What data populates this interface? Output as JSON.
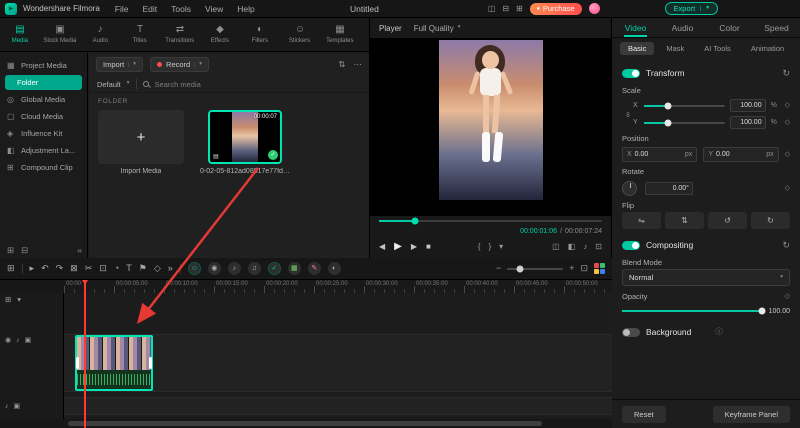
{
  "colors": {
    "accent": "#00c9a3",
    "selection": "#00e5b4",
    "purchase": "#ff5f3d",
    "record_dot": "#ff4d4f",
    "check_badge": "#2ecc71",
    "annotation_arrow": "#e53935",
    "playhead": "#ff3b30"
  },
  "icons": {
    "logo": "▶",
    "caret": "▾",
    "more": "⋯",
    "filter": "⇅",
    "plus": "+",
    "check": "✓",
    "reset": "↻",
    "keyframe": "◇",
    "info": "ⓘ",
    "link": "∞",
    "layout": "◫",
    "screen": "⊟",
    "mini": "⊞",
    "gem": "♦",
    "new_folder": "⊞",
    "del_folder": "⊟",
    "collapse": "«",
    "clip_type": "▤",
    "prev": "◀",
    "play": "▶",
    "next": "▶",
    "stop": "■",
    "brace_l": "{",
    "brace_r": "}",
    "mark_down": "▾",
    "display": "◫",
    "snapshot": "◧",
    "speaker": "♪",
    "fit": "⊡",
    "flip_h": "⇋",
    "flip_v": "⇅",
    "rot_ccw": "↺",
    "rot_cw": "↻",
    "tl_tracks": "⊞",
    "tl_pointer": "▸",
    "tl_undo": "↶",
    "tl_redo": "↷",
    "tl_delete": "⊠",
    "tl_split": "✂",
    "tl_crop": "⊡",
    "tl_speed": "◔",
    "tl_text": "T",
    "tl_marker": "⚑",
    "tl_keyframe": "◇",
    "tl_more": "»",
    "zoom_out": "−",
    "zoom_in": "+",
    "f1": "☺",
    "f2": "◉",
    "f3": "♪",
    "f4": "♫",
    "f5": "✓",
    "f6": "▦",
    "f7": "✎",
    "f8": "◐",
    "eye": "◉",
    "mute": "♪",
    "lock": "▣",
    "add_track": "⊞",
    "track_caret": "▾"
  },
  "menubar": {
    "app": "Wondershare Filmora",
    "menus": [
      "File",
      "Edit",
      "Tools",
      "View",
      "Help"
    ],
    "title": "Untitled",
    "purchase": "Purchase",
    "export": "Export"
  },
  "media_tabs": [
    {
      "label": "Media",
      "icon": "▤"
    },
    {
      "label": "Stock Media",
      "icon": "▣"
    },
    {
      "label": "Audio",
      "icon": "♪"
    },
    {
      "label": "Titles",
      "icon": "T"
    },
    {
      "label": "Transitions",
      "icon": "⇄"
    },
    {
      "label": "Effects",
      "icon": "◆"
    },
    {
      "label": "Filters",
      "icon": "◐"
    },
    {
      "label": "Stickers",
      "icon": "☺"
    },
    {
      "label": "Templates",
      "icon": "▦"
    }
  ],
  "sidebar": {
    "items": [
      {
        "label": "Project Media",
        "icon": "▦"
      },
      {
        "label": "Folder",
        "icon": ""
      },
      {
        "label": "Global Media",
        "icon": "◎"
      },
      {
        "label": "Cloud Media",
        "icon": "▢"
      },
      {
        "label": "Influence Kit",
        "icon": "◈"
      },
      {
        "label": "Adjustment La...",
        "icon": "◧"
      },
      {
        "label": "Compound Clip",
        "icon": "⊞"
      }
    ]
  },
  "media": {
    "import_btn": "Import",
    "record_btn": "Record",
    "default_dropdown": "Default",
    "search_placeholder": "Search media",
    "section_label": "FOLDER",
    "import_tile_label": "Import Media",
    "clip_name": "0-02-05-812ad08517e77fd6...",
    "clip_duration": "00:00:07"
  },
  "player": {
    "label": "Player",
    "quality": "Full Quality",
    "current_time": "00:00:01:06",
    "separator": "/",
    "total_time": "00:00:07:24"
  },
  "props": {
    "tabs": [
      "Video",
      "Audio",
      "Color",
      "Speed"
    ],
    "subtabs": [
      "Basic",
      "Mask",
      "AI Tools",
      "Animation"
    ],
    "transform": {
      "title": "Transform",
      "scale_label": "Scale",
      "x_label": "X",
      "y_label": "Y",
      "scale_x": "100.00",
      "scale_y": "100.00",
      "scale_unit": "%",
      "position_label": "Position",
      "pos_x": "0.00",
      "pos_y": "0.00",
      "pos_unit": "px",
      "rotate_label": "Rotate",
      "rotate_value": "0.00°",
      "flip_label": "Flip"
    },
    "compositing": {
      "title": "Compositing",
      "blend_label": "Blend Mode",
      "blend_value": "Normal",
      "opacity_label": "Opacity",
      "opacity_value": "100.00"
    },
    "background": {
      "title": "Background"
    },
    "footer": {
      "reset": "Reset",
      "keyframe": "Keyframe Panel"
    }
  },
  "timeline": {
    "ruler": [
      "00:00",
      "00:00:05:00",
      "00:00:10:00",
      "00:00:15:00",
      "00:00:20:00",
      "00:00:25:00",
      "00:00:30:00",
      "00:00:35:00",
      "00:00:40:00",
      "00:00:45:00",
      "00:00:50:00"
    ]
  }
}
